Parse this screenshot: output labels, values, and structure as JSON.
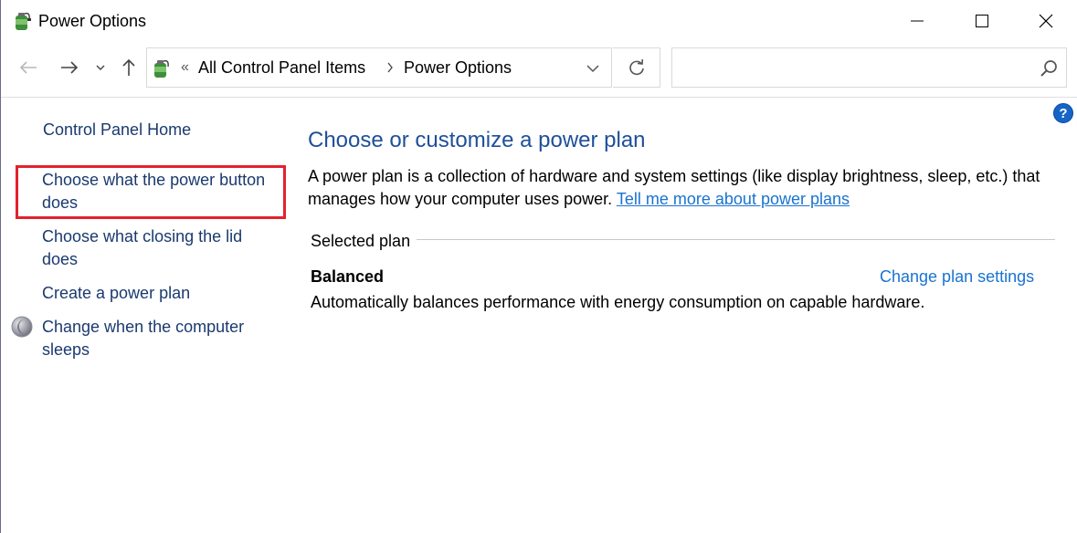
{
  "window": {
    "title": "Power Options",
    "controls": {
      "minimize": "minimize-icon",
      "maximize": "maximize-icon",
      "close": "close-icon"
    }
  },
  "nav": {
    "breadcrumb": [
      "All Control Panel Items",
      "Power Options"
    ],
    "overflow_glyph": "«",
    "search_placeholder": ""
  },
  "sidebar": {
    "home": "Control Panel Home",
    "items": [
      {
        "label": "Choose what the power button does",
        "highlighted": true
      },
      {
        "label": "Choose what closing the lid does"
      },
      {
        "label": "Create a power plan"
      },
      {
        "label": "Change when the computer sleeps",
        "icon": "moon-icon"
      }
    ]
  },
  "main": {
    "title": "Choose or customize a power plan",
    "description": "A power plan is a collection of hardware and system settings (like display brightness, sleep, etc.) that manages how your computer uses power.",
    "description_link": "Tell me more about power plans",
    "section_label": "Selected plan",
    "plan": {
      "name": "Balanced",
      "change_link": "Change plan settings",
      "description": "Automatically balances performance with energy consumption on capable hardware."
    }
  },
  "help": "?",
  "colors": {
    "heading": "#1e4f9a",
    "link": "#1a73d0",
    "sidebar_link": "#1a3a6e",
    "highlight_border": "#e3212d",
    "help_bg": "#1565c8"
  }
}
